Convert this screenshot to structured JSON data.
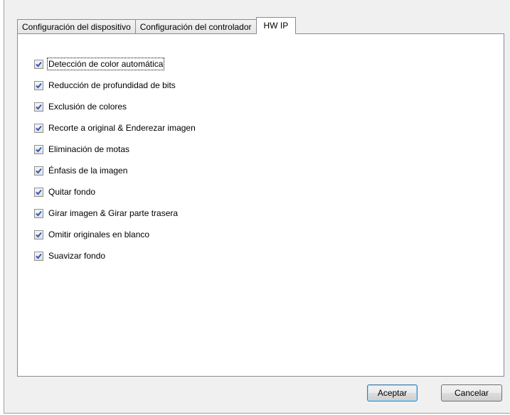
{
  "tabs": [
    {
      "label": "Configuración del dispositivo",
      "active": false
    },
    {
      "label": "Configuración del controlador",
      "active": false
    },
    {
      "label": "HW IP",
      "active": true
    }
  ],
  "options": [
    {
      "label": "Detección de color automática",
      "checked": true
    },
    {
      "label": "Reducción de profundidad de bits",
      "checked": true
    },
    {
      "label": "Exclusión de colores",
      "checked": true
    },
    {
      "label": "Recorte a original & Enderezar imagen",
      "checked": true
    },
    {
      "label": "Eliminación de motas",
      "checked": true
    },
    {
      "label": "Énfasis de la imagen",
      "checked": true
    },
    {
      "label": "Quitar fondo",
      "checked": true
    },
    {
      "label": "Girar imagen & Girar parte trasera",
      "checked": true
    },
    {
      "label": "Omitir originales en blanco",
      "checked": true
    },
    {
      "label": "Suavizar fondo",
      "checked": true
    }
  ],
  "buttons": {
    "accept_label": "Aceptar",
    "cancel_label": "Cancelar"
  },
  "colors": {
    "checkmark": "#2a5bb5"
  }
}
